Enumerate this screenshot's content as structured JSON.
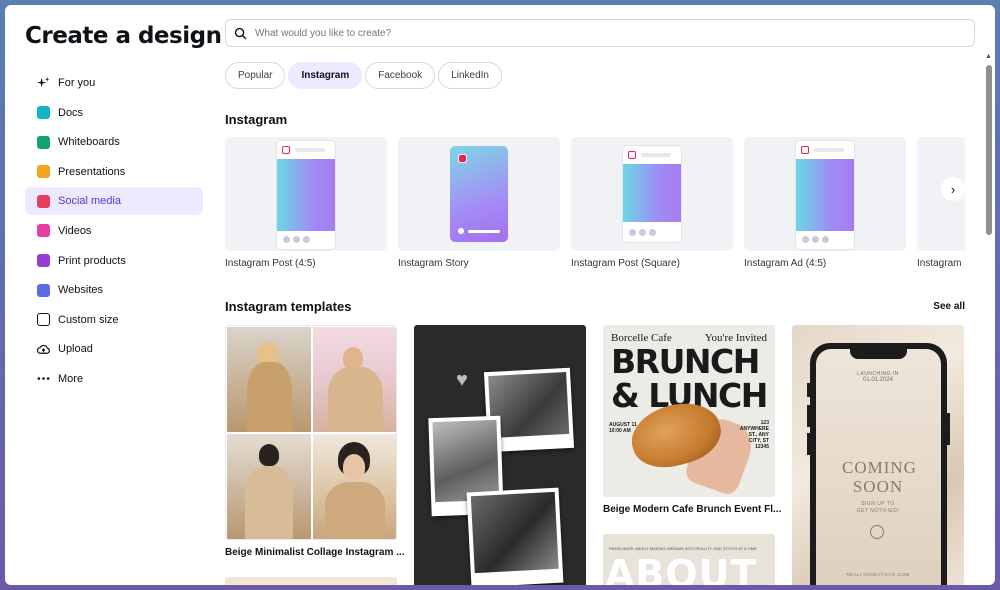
{
  "sidebar": {
    "title": "Create a design",
    "items": [
      {
        "label": "For you",
        "icon": "sparkle-icon"
      },
      {
        "label": "Docs",
        "icon": "docs-icon"
      },
      {
        "label": "Whiteboards",
        "icon": "whiteboard-icon"
      },
      {
        "label": "Presentations",
        "icon": "presentation-icon"
      },
      {
        "label": "Social media",
        "icon": "heart-icon",
        "active": true
      },
      {
        "label": "Videos",
        "icon": "video-icon"
      },
      {
        "label": "Print products",
        "icon": "printer-icon"
      },
      {
        "label": "Websites",
        "icon": "website-icon"
      },
      {
        "label": "Custom size",
        "icon": "crop-icon"
      },
      {
        "label": "Upload",
        "icon": "upload-icon"
      },
      {
        "label": "More",
        "icon": "more-dots-icon"
      }
    ]
  },
  "search": {
    "placeholder": "What would you like to create?"
  },
  "chips": [
    {
      "label": "Popular"
    },
    {
      "label": "Instagram",
      "active": true
    },
    {
      "label": "Facebook"
    },
    {
      "label": "LinkedIn"
    }
  ],
  "formats_section": {
    "title": "Instagram",
    "items": [
      {
        "label": "Instagram Post (4:5)"
      },
      {
        "label": "Instagram Story"
      },
      {
        "label": "Instagram Post (Square)"
      },
      {
        "label": "Instagram Ad (4:5)"
      },
      {
        "label": "Instagram"
      }
    ]
  },
  "templates_section": {
    "title": "Instagram templates",
    "see_all": "See all",
    "captions": {
      "collage": "Beige Minimalist Collage Instagram ...",
      "brunch": "Beige Modern Cafe Brunch Event Fl..."
    },
    "brunch": {
      "left_top": "Borcelle Cafe",
      "right_top": "You're Invited",
      "big": "BRUNCH & LUNCH",
      "date": "AUGUST 11",
      "time": "10:00 AM",
      "addr1": "123",
      "addr2": "ANYWHERE",
      "addr3": "ST., ANY",
      "addr4": "CITY, ST",
      "addr5": "12345"
    },
    "aboutme": {
      "small": "PASSIONATE ABOUT MAKING DREAMS INTO REALITY ONE STITCH AT A TIME",
      "big": "ABOUT ME"
    },
    "coming": {
      "launch": "LAUNCHING IN",
      "date": "01.01.2024",
      "title": "COMING SOON",
      "sub1": "SIGN UP TO",
      "sub2": "GET NOTIFIED!",
      "site": "REALLYGREATSITE.COM"
    }
  },
  "colors": {
    "accent": "#5a32d6",
    "active_bg": "#ede9fe"
  }
}
